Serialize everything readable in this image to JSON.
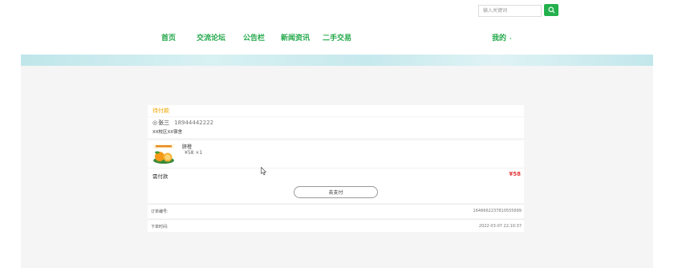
{
  "header": {
    "search_placeholder": "输入关键词",
    "search_icon": "search-icon",
    "nav": [
      "首页",
      "交流论坛",
      "公告栏",
      "新闻资讯",
      "二手交易"
    ],
    "mine_label": "我的",
    "mine_caret": "-"
  },
  "order": {
    "status": "待付款",
    "address": {
      "name": "张三",
      "phone": "18944442222",
      "detail": "XX校区XX宿舍"
    },
    "goods": {
      "name": "脐橙",
      "price": "¥58 ×1"
    },
    "payable_label": "需付款",
    "payable_amount": "¥58",
    "pay_button": "去支付",
    "order_no_label": "订单编号:",
    "order_no": "1646662237810555699",
    "order_time_label": "下单时间:",
    "order_time": "2022-03-07 22:10:37"
  },
  "colors": {
    "brand_green": "#23a84a",
    "status_orange": "#f0a500",
    "price_red": "#e4393c"
  }
}
